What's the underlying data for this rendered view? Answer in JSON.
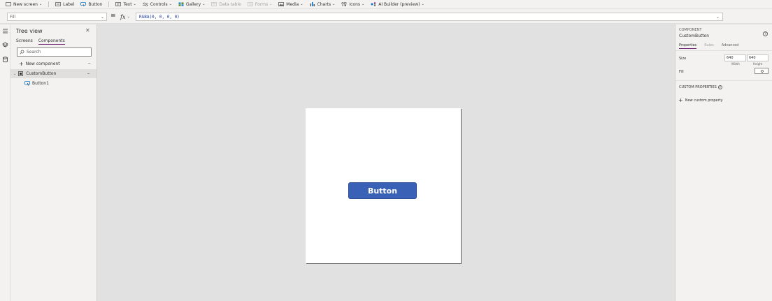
{
  "ribbon": {
    "items": [
      {
        "label": "New screen",
        "icon": "new-screen-icon",
        "dropdown": true,
        "enabled": true
      },
      {
        "label": "Label",
        "icon": "label-icon",
        "dropdown": false,
        "enabled": true
      },
      {
        "label": "Button",
        "icon": "button-icon",
        "dropdown": false,
        "enabled": true
      },
      {
        "label": "Text",
        "icon": "text-icon",
        "dropdown": true,
        "enabled": true
      },
      {
        "label": "Controls",
        "icon": "controls-icon",
        "dropdown": true,
        "enabled": true
      },
      {
        "label": "Gallery",
        "icon": "gallery-icon",
        "dropdown": true,
        "enabled": true
      },
      {
        "label": "Data table",
        "icon": "data-table-icon",
        "dropdown": false,
        "enabled": false
      },
      {
        "label": "Forms",
        "icon": "forms-icon",
        "dropdown": true,
        "enabled": false
      },
      {
        "label": "Media",
        "icon": "media-icon",
        "dropdown": true,
        "enabled": true
      },
      {
        "label": "Charts",
        "icon": "charts-icon",
        "dropdown": true,
        "enabled": true
      },
      {
        "label": "Icons",
        "icon": "icons-icon",
        "dropdown": true,
        "enabled": true
      },
      {
        "label": "AI Builder (preview)",
        "icon": "ai-builder-icon",
        "dropdown": true,
        "enabled": true
      }
    ]
  },
  "formula_bar": {
    "property": "Fill",
    "equals": "=",
    "fx": "fx",
    "formula": "RGBA(0, 0, 0, 0)"
  },
  "tree_view": {
    "title": "Tree view",
    "tabs": [
      {
        "label": "Screens",
        "active": false
      },
      {
        "label": "Components",
        "active": true
      }
    ],
    "search_placeholder": "Search",
    "new_component": "New component",
    "more": "···",
    "component": "CustomButton",
    "child": "Button1"
  },
  "canvas": {
    "button_label": "Button"
  },
  "properties_pane": {
    "kind": "COMPONENT",
    "name": "CustomButton",
    "tabs": [
      {
        "label": "Properties",
        "state": "active"
      },
      {
        "label": "Rules",
        "state": "dim"
      },
      {
        "label": "Advanced",
        "state": "normal"
      }
    ],
    "size_label": "Size",
    "width_value": "640",
    "height_value": "640",
    "width_label": "Width",
    "height_label": "Height",
    "fill_label": "Fill",
    "custom_properties_label": "CUSTOM PROPERTIES",
    "new_custom_property": "New custom property"
  },
  "colors": {
    "accent": "#742774",
    "button_fill": "#3961b5",
    "canvas_bg": "#e1e1e1",
    "pane_bg": "#f3f2f1"
  }
}
